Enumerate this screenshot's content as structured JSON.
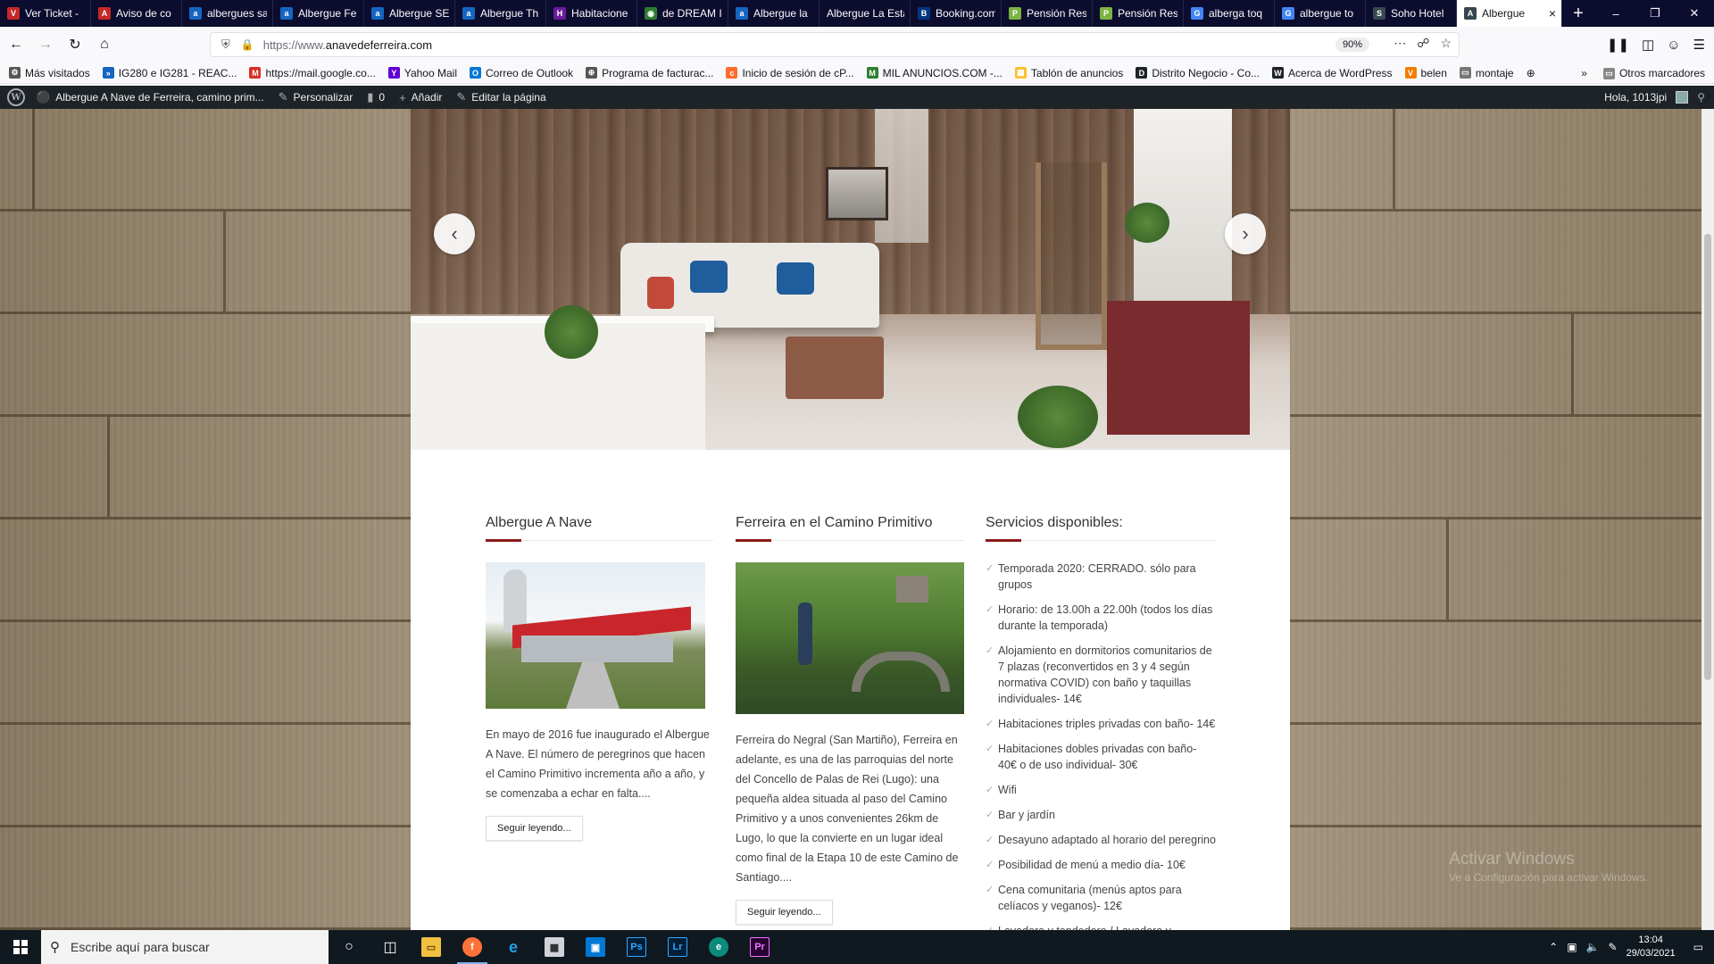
{
  "browser": {
    "tabs": [
      {
        "label": "Ver Ticket - ",
        "fav_color": "#c62828",
        "fav_glyph": "V"
      },
      {
        "label": "Aviso de co",
        "fav_color": "#c62828",
        "fav_glyph": "A"
      },
      {
        "label": "albergues sa",
        "fav_color": "#1565c0",
        "fav_glyph": "a"
      },
      {
        "label": "Albergue Fe",
        "fav_color": "#1565c0",
        "fav_glyph": "a"
      },
      {
        "label": "Albergue SE",
        "fav_color": "#1565c0",
        "fav_glyph": "a"
      },
      {
        "label": "Albergue Th",
        "fav_color": "#1565c0",
        "fav_glyph": "a"
      },
      {
        "label": "Habitacione",
        "fav_color": "#6a1b9a",
        "fav_glyph": "H"
      },
      {
        "label": "de DREAM I",
        "fav_color": "#2e7d32",
        "fav_glyph": "◉"
      },
      {
        "label": "Albergue la",
        "fav_color": "#1565c0",
        "fav_glyph": "a"
      },
      {
        "label": "Albergue La Esta",
        "fav_color": "#0c0c2e",
        "fav_glyph": ""
      },
      {
        "label": "Booking.com",
        "fav_color": "#003580",
        "fav_glyph": "B"
      },
      {
        "label": "Pensión Resi",
        "fav_color": "#7cb342",
        "fav_glyph": "P"
      },
      {
        "label": "Pensión Resi",
        "fav_color": "#7cb342",
        "fav_glyph": "P"
      },
      {
        "label": "alberga toq",
        "fav_color": "#4285f4",
        "fav_glyph": "G"
      },
      {
        "label": "albergue to",
        "fav_color": "#4285f4",
        "fav_glyph": "G"
      },
      {
        "label": "Soho Hotel",
        "fav_color": "#37474f",
        "fav_glyph": "S"
      },
      {
        "label": "Albergue",
        "fav_color": "#37474f",
        "fav_glyph": "A",
        "active": true
      }
    ],
    "url_protocol": "https://www.",
    "url_host": "anavedeferreira.com",
    "zoom": "90%"
  },
  "bookmarks": [
    {
      "label": "Más visitados",
      "color": "#555555",
      "glyph": "⚙"
    },
    {
      "label": "IG280 e IG281 - REAC...",
      "color": "#1565c0",
      "glyph": "»"
    },
    {
      "label": "https://mail.google.co...",
      "color": "#d93025",
      "glyph": "M"
    },
    {
      "label": "Yahoo Mail",
      "color": "#5f01d1",
      "glyph": "Y"
    },
    {
      "label": "Correo de Outlook",
      "color": "#0078d4",
      "glyph": "O"
    },
    {
      "label": "Programa de facturac...",
      "color": "#555555",
      "glyph": "⊕"
    },
    {
      "label": "Inicio de sesión de cP...",
      "color": "#ff6c2c",
      "glyph": "c"
    },
    {
      "label": "MIL ANUNCIOS.COM -...",
      "color": "#2e7d32",
      "glyph": "M"
    },
    {
      "label": "Tablón de anuncios",
      "color": "#fbc02d",
      "glyph": "▦"
    },
    {
      "label": "Distrito Negocio - Co...",
      "color": "#1d2327",
      "glyph": "D"
    },
    {
      "label": "Acerca de WordPress",
      "color": "#1d2327",
      "glyph": "W"
    },
    {
      "label": "belen",
      "color": "#f57c00",
      "glyph": "V"
    },
    {
      "label": "montaje",
      "color": "#777777",
      "glyph": "▭"
    }
  ],
  "bookmarks_other": "Otros marcadores",
  "wpbar": {
    "site": "Albergue A Nave de Ferreira, camino prim...",
    "customize": "Personalizar",
    "comments": "0",
    "add": "Añadir",
    "edit": "Editar la página",
    "greeting": "Hola, 1013jpi"
  },
  "columns": {
    "c1": {
      "title": "Albergue A Nave",
      "text": "En mayo de 2016 fue inaugurado el Albergue A Nave. El número de peregrinos que hacen el Camino Primitivo incrementa año a año, y se comenzaba a echar en falta....",
      "button": "Seguir leyendo..."
    },
    "c2": {
      "title": "Ferreira en el Camino Primitivo",
      "text": "Ferreira do Negral (San Martiño), Ferreira en adelante, es una de las parroquias del norte del Concello de Palas de Rei (Lugo): una pequeña aldea situada al paso del Camino Primitivo y a unos convenientes 26km de Lugo, lo que la convierte en un lugar ideal como final de la Etapa 10 de este Camino de Santiago....",
      "button": "Seguir leyendo..."
    },
    "c3": {
      "title": "Servicios disponibles:",
      "items": [
        "Temporada 2020: CERRADO. sólo para grupos",
        "Horario: de 13.00h a 22.00h (todos los días durante la temporada)",
        "Alojamiento en dormitorios comunitarios de 7 plazas (reconvertidos en 3 y 4 según normativa COVID) con baño y taquillas individuales- 14€",
        "Habitaciones triples privadas con baño- 14€",
        "Habitaciones dobles privadas con baño- 40€ o de uso individual- 30€",
        "Wifi",
        "Bar y jardín",
        "Desayuno adaptado al horario del peregrino",
        "Posibilidad de menú a medio día- 10€",
        "Cena comunitaria (menús aptos para celíacos y veganos)- 12€",
        "Lavadora y tendedero / Lavadora y secadora"
      ]
    }
  },
  "watermark": {
    "line1": "Activar Windows",
    "line2": "Ve a Configuración para activar Windows."
  },
  "taskbar": {
    "search_placeholder": "Escribe aquí para buscar",
    "time": "13:04",
    "date": "29/03/2021"
  }
}
